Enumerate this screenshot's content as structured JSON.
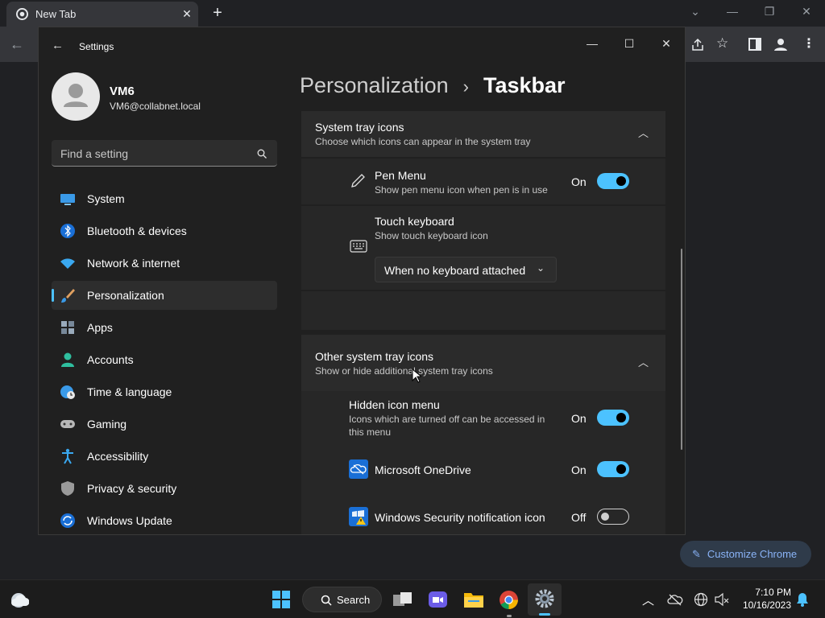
{
  "chrome": {
    "tab_title": "New Tab",
    "customize_label": "Customize Chrome"
  },
  "settings": {
    "window_title": "Settings",
    "user": {
      "name": "VM6",
      "email": "VM6@collabnet.local"
    },
    "search": {
      "placeholder": "Find a setting"
    },
    "nav": [
      {
        "label": "System",
        "icon": "system-icon"
      },
      {
        "label": "Bluetooth & devices",
        "icon": "bluetooth-icon"
      },
      {
        "label": "Network & internet",
        "icon": "wifi-icon"
      },
      {
        "label": "Personalization",
        "icon": "brush-icon",
        "selected": true
      },
      {
        "label": "Apps",
        "icon": "apps-icon"
      },
      {
        "label": "Accounts",
        "icon": "person-icon"
      },
      {
        "label": "Time & language",
        "icon": "globe-clock-icon"
      },
      {
        "label": "Gaming",
        "icon": "gamepad-icon"
      },
      {
        "label": "Accessibility",
        "icon": "accessibility-icon"
      },
      {
        "label": "Privacy & security",
        "icon": "shield-icon"
      },
      {
        "label": "Windows Update",
        "icon": "update-icon"
      }
    ],
    "breadcrumb": {
      "parent": "Personalization",
      "separator": "›",
      "current": "Taskbar"
    },
    "system_tray": {
      "title": "System tray icons",
      "subtitle": "Choose which icons can appear in the system tray",
      "pen_menu": {
        "title": "Pen Menu",
        "subtitle": "Show pen menu icon when pen is in use",
        "state": "On"
      },
      "touch_keyboard": {
        "title": "Touch keyboard",
        "subtitle": "Show touch keyboard icon",
        "dropdown_value": "When no keyboard attached"
      }
    },
    "other_tray": {
      "title": "Other system tray icons",
      "subtitle": "Show or hide additional system tray icons",
      "hidden_icon_menu": {
        "title": "Hidden icon menu",
        "subtitle_line1": "Icons which are turned off can be accessed in",
        "subtitle_line2": "this menu",
        "state": "On"
      },
      "onedrive": {
        "title": "Microsoft OneDrive",
        "state": "On"
      },
      "security": {
        "title": "Windows Security notification icon",
        "state": "Off"
      }
    }
  },
  "taskbar": {
    "search_label": "Search",
    "time": "7:10 PM",
    "date": "10/16/2023"
  },
  "colors": {
    "accent": "#4cc2ff",
    "window_bg": "#202020",
    "card_bg": "#2b2b2b"
  }
}
